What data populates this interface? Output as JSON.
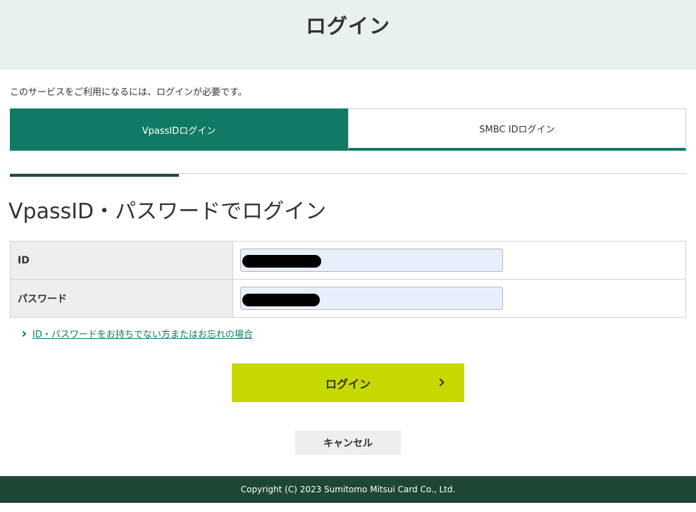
{
  "header": {
    "title": "ログイン"
  },
  "notice": "このサービスをご利用になるには、ログインが必要です。",
  "tabs": [
    {
      "label": "VpassIDログイン",
      "active": true
    },
    {
      "label": "SMBC IDログイン",
      "active": false
    }
  ],
  "section": {
    "title": "VpassID・パスワードでログイン"
  },
  "form": {
    "id_label": "ID",
    "id_value": "",
    "password_label": "パスワード",
    "password_value": ""
  },
  "help_link": "ID・パスワードをお持ちでない方またはお忘れの場合",
  "buttons": {
    "login": "ログイン",
    "cancel": "キャンセル"
  },
  "footer": {
    "copyright": "Copyright (C) 2023 Sumitomo Mitsui Card Co., Ltd."
  },
  "colors": {
    "brand_green": "#117a65",
    "dark_green": "#1e4733",
    "login_button": "#c5d800",
    "header_bg": "#e8f1ef"
  },
  "icons": {
    "help_link_icon": "chevron-right-icon",
    "login_icon": "chevron-right-icon"
  }
}
